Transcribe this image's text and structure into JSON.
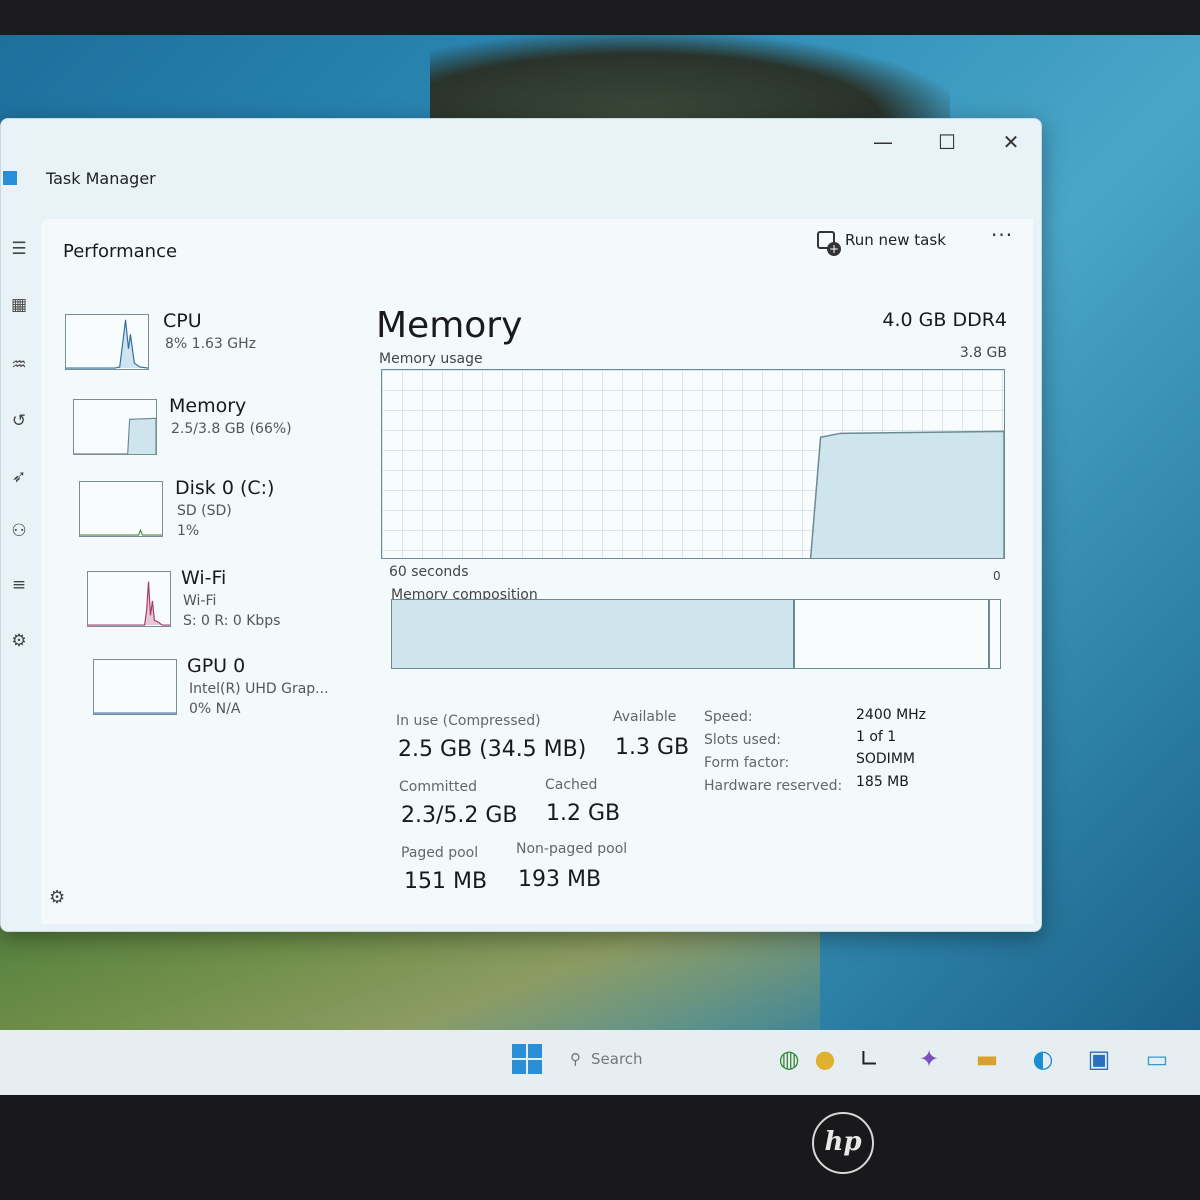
{
  "window": {
    "title": "Task Manager",
    "minimize": "—",
    "maximize": "☐",
    "close": "✕"
  },
  "page": {
    "section_title": "Performance",
    "run_new_task": "Run new task",
    "more": "···"
  },
  "sidebar": [
    {
      "name": "CPU",
      "lines": [
        "8% 1.63 GHz"
      ]
    },
    {
      "name": "Memory",
      "lines": [
        "2.5/3.8 GB (66%)"
      ]
    },
    {
      "name": "Disk 0 (C:)",
      "lines": [
        "SD (SD)",
        "1%"
      ]
    },
    {
      "name": "Wi-Fi",
      "lines": [
        "Wi-Fi",
        "S: 0 R: 0 Kbps"
      ]
    },
    {
      "name": "GPU 0",
      "lines": [
        "Intel(R) UHD Grap...",
        "0% N/A"
      ]
    }
  ],
  "detail": {
    "title": "Memory",
    "capacity": "4.0 GB DDR4",
    "usage_label": "Memory usage",
    "max_label": "3.8 GB",
    "min_label": "0",
    "time_label": "60 seconds",
    "composition_label": "Memory composition",
    "stats": {
      "in_use_label": "In use (Compressed)",
      "in_use_value": "2.5 GB (34.5 MB)",
      "available_label": "Available",
      "available_value": "1.3 GB",
      "committed_label": "Committed",
      "committed_value": "2.3/5.2 GB",
      "cached_label": "Cached",
      "cached_value": "1.2 GB",
      "paged_label": "Paged pool",
      "paged_value": "151 MB",
      "nonpaged_label": "Non-paged pool",
      "nonpaged_value": "193 MB"
    },
    "specs": [
      {
        "label": "Speed:",
        "value": "2400 MHz"
      },
      {
        "label": "Slots used:",
        "value": "1 of 1"
      },
      {
        "label": "Form factor:",
        "value": "SODIMM"
      },
      {
        "label": "Hardware reserved:",
        "value": "185 MB"
      }
    ],
    "composition": {
      "in_use_fraction": 0.66,
      "modified_fraction": 0.02
    }
  },
  "taskbar": {
    "search_placeholder": "Search"
  },
  "colors": {
    "memory_accent": "#6b8a95",
    "memory_fill": "#cfe5ee"
  }
}
